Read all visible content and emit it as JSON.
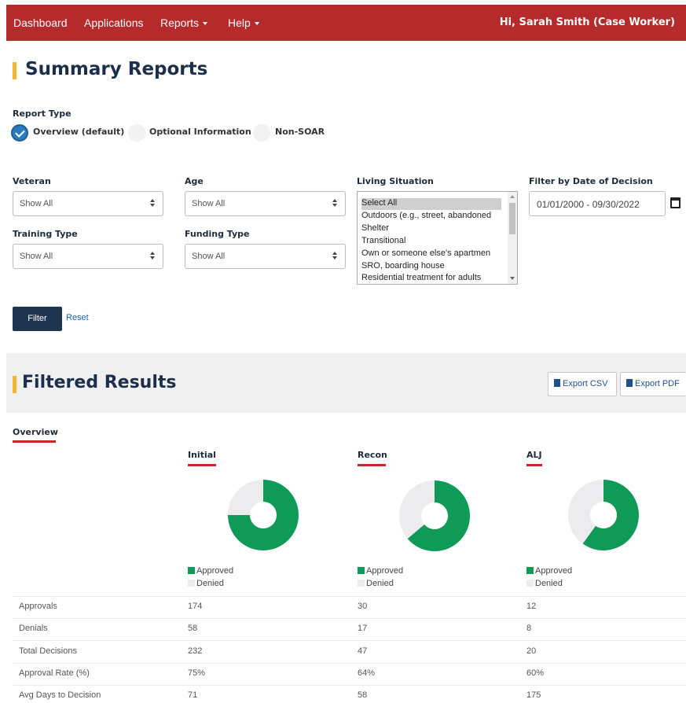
{
  "nav": {
    "items": [
      "Dashboard",
      "Applications",
      "Reports",
      "Help"
    ],
    "user": "Hi, Sarah Smith (Case Worker)",
    "color": "#b52a2a"
  },
  "summary": {
    "title": "Summary Reports",
    "report_type_label": "Report Type",
    "radios": [
      {
        "label": "Overview (default)",
        "checked": true
      },
      {
        "label": "Optional Information",
        "checked": false
      },
      {
        "label": "Non-SOAR",
        "checked": false
      }
    ]
  },
  "filters": {
    "veteran": {
      "label": "Veteran",
      "value": "Show All"
    },
    "age": {
      "label": "Age",
      "value": "Show All"
    },
    "training": {
      "label": "Training Type",
      "value": "Show All"
    },
    "funding": {
      "label": "Funding Type",
      "value": "Show All"
    },
    "living": {
      "label": "Living Situation",
      "options": [
        "Select All",
        "Outdoors (e.g., street, abandoned",
        "Shelter",
        "Transitional",
        "Own or someone else's apartmen",
        "SRO, boarding house",
        "Residential treatment for adults"
      ],
      "selected": "Select All"
    },
    "date": {
      "label": "Filter by Date of Decision",
      "value": "01/01/2000 - 09/30/2022"
    },
    "filter_button": "Filter",
    "reset_link": "Reset"
  },
  "results": {
    "title": "Filtered Results",
    "export_csv": "Export CSV",
    "export_pdf": "Export PDF",
    "tab": "Overview",
    "columns": [
      {
        "name": "Initial",
        "approved": 174,
        "denied": 58
      },
      {
        "name": "Recon",
        "approved": 30,
        "denied": 17
      },
      {
        "name": "ALJ",
        "approved": 12,
        "denied": 8
      }
    ],
    "legend": {
      "approved": "Approved",
      "denied": "Denied"
    },
    "colors": {
      "approved": "#0f9a57",
      "denied": "#ececee"
    },
    "rows": [
      {
        "label": "Approvals",
        "values": [
          "174",
          "30",
          "12"
        ]
      },
      {
        "label": "Denials",
        "values": [
          "58",
          "17",
          "8"
        ]
      },
      {
        "label": "Total Decisions",
        "values": [
          "232",
          "47",
          "20"
        ]
      },
      {
        "label": "Approval Rate (%)",
        "values": [
          "75%",
          "64%",
          "60%"
        ]
      },
      {
        "label": "Avg Days to Decision",
        "values": [
          "71",
          "58",
          "175"
        ]
      }
    ]
  },
  "chart_data": [
    {
      "type": "pie",
      "title": "Initial",
      "categories": [
        "Approved",
        "Denied"
      ],
      "values": [
        174,
        58
      ]
    },
    {
      "type": "pie",
      "title": "Recon",
      "categories": [
        "Approved",
        "Denied"
      ],
      "values": [
        30,
        17
      ]
    },
    {
      "type": "pie",
      "title": "ALJ",
      "categories": [
        "Approved",
        "Denied"
      ],
      "values": [
        12,
        8
      ]
    }
  ]
}
